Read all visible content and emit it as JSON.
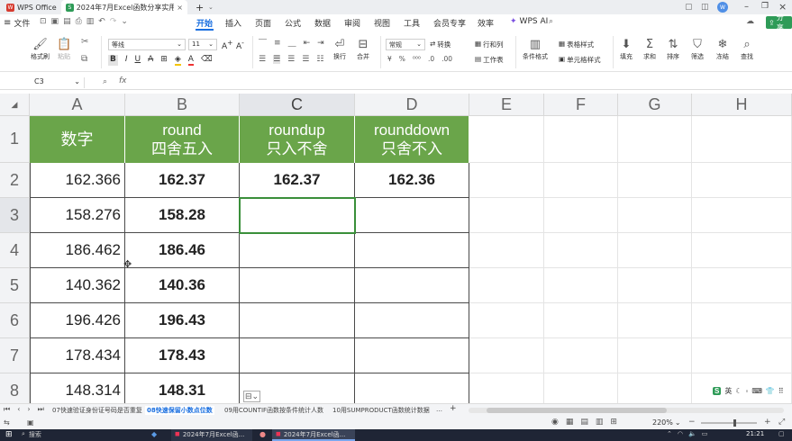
{
  "titlebar": {
    "app_tab": "WPS Office",
    "doc_tab": "2024年7月Excel函数分享实用…",
    "new_tab": "+",
    "badge_initials": "W"
  },
  "menubar": {
    "file": "文件",
    "items": [
      "开始",
      "插入",
      "页面",
      "公式",
      "数据",
      "审阅",
      "视图",
      "工具",
      "会员专享",
      "效率"
    ],
    "wps_ai": "WPS AI",
    "share": "分享"
  },
  "ribbon": {
    "format_painter": "格式刷",
    "paste": "粘贴",
    "font_name": "等线",
    "font_size": "11",
    "wrap": "换行",
    "merge": "合并",
    "number_format": "常规",
    "convert": "转换",
    "row_col": "行和列",
    "worksheet": "工作表",
    "cond_format": "条件格式",
    "table_style": "表格样式",
    "cell_style": "单元格样式",
    "fill": "填充",
    "sum": "求和",
    "sort": "排序",
    "filter": "筛选",
    "freeze": "冻结",
    "find": "查找"
  },
  "formulabar": {
    "name_box": "C3",
    "fx": "fx",
    "formula": ""
  },
  "grid": {
    "columns": [
      "A",
      "B",
      "C",
      "D",
      "E",
      "F",
      "G",
      "H"
    ],
    "rows": [
      "1",
      "2",
      "3",
      "4",
      "5",
      "6",
      "7",
      "8"
    ],
    "headers": [
      [
        "数字",
        ""
      ],
      [
        "round",
        "四舍五入"
      ],
      [
        "roundup",
        "只入不舍"
      ],
      [
        "rounddown",
        "只舍不入"
      ]
    ],
    "data": [
      [
        "162.366",
        "162.37",
        "162.37",
        "162.36"
      ],
      [
        "158.276",
        "158.28",
        "",
        ""
      ],
      [
        "186.462",
        "186.46",
        "",
        ""
      ],
      [
        "140.362",
        "140.36",
        "",
        ""
      ],
      [
        "196.426",
        "196.43",
        "",
        ""
      ],
      [
        "178.434",
        "178.43",
        "",
        ""
      ],
      [
        "148.314",
        "148.31",
        "",
        ""
      ]
    ],
    "selected": "C3",
    "header_color": "#6aa54a",
    "selection_color": "#3a8f3a"
  },
  "sheetbar": {
    "tabs": [
      "07快速验证身份证号码是否重复",
      "08快速保留小数点位数",
      "09用COUNTIF函数按条件统计人数",
      "10用SUMPRODUCT函数统计数据"
    ],
    "active_index": 1,
    "more": "…",
    "add": "+"
  },
  "statusbar": {
    "zoom": "220%",
    "ime": "英"
  },
  "taskbar": {
    "search": "搜索",
    "window1": "2024年7月Excel函...",
    "window2": "2024年7月Excel函...",
    "time": "21:21"
  }
}
